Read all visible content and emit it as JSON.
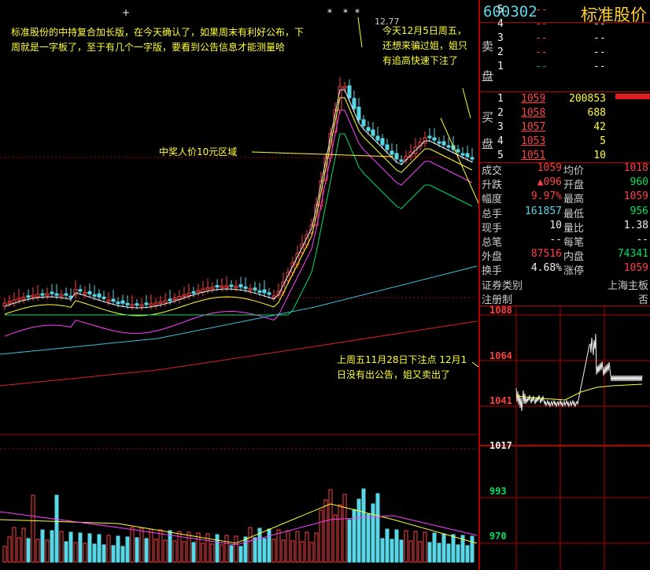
{
  "stock": {
    "code": "600302",
    "name": "标准股价"
  },
  "chart": {
    "peak_label": "12.77",
    "annotations": {
      "top_left": "标准股份的中持复合加长版，在今天确认了，如果周末有利好公布，下周就是一字板了，至于有几个一字版，要看到公告信息才能测量哈",
      "top_right": "今天12月5日周五，还想来骗过姐，姐只有追高快速下注了",
      "mid": "中奖人价10元区域",
      "lower": "上周五11月28日下注点 12月1日没有出公告，姐又卖出了"
    },
    "markers": [
      "+",
      "*",
      "*",
      "*"
    ]
  },
  "order_book": {
    "sell_label": "卖盘",
    "buy_label": "买盘",
    "sells": [
      {
        "level": "5",
        "price": "--",
        "vol": "--"
      },
      {
        "level": "4",
        "price": "--",
        "vol": "--"
      },
      {
        "level": "3",
        "price": "--",
        "vol": "--"
      },
      {
        "level": "2",
        "price": "--",
        "vol": "--"
      },
      {
        "level": "1",
        "price": "--",
        "vol": "--"
      }
    ],
    "buys": [
      {
        "level": "1",
        "price": "1059",
        "vol": "200853"
      },
      {
        "level": "2",
        "price": "1058",
        "vol": "688"
      },
      {
        "level": "3",
        "price": "1057",
        "vol": "42"
      },
      {
        "level": "4",
        "price": "1053",
        "vol": "5"
      },
      {
        "level": "5",
        "price": "1051",
        "vol": "10"
      }
    ]
  },
  "stats": {
    "r1": {
      "l1": "成交",
      "v1": "1059",
      "l2": "均价",
      "v2": "1018"
    },
    "r2": {
      "l1": "升跌",
      "v1": "▲096",
      "l2": "开盘",
      "v2": "960"
    },
    "r3": {
      "l1": "幅度",
      "v1": "9.97%",
      "l2": "最高",
      "v2": "1059"
    },
    "r4": {
      "l1": "总手",
      "v1": "161857",
      "l2": "最低",
      "v2": "956"
    },
    "r5": {
      "l1": "现手",
      "v1": "10",
      "l2": "量比",
      "v2": "1.38"
    },
    "r6": {
      "l1": "总笔",
      "v1": "--",
      "l2": "每笔",
      "v2": "--"
    },
    "r7": {
      "l1": "外盘",
      "v1": "87516",
      "l2": "内盘",
      "v2": "74341"
    },
    "r8": {
      "l1": "换手",
      "v1": "4.68%",
      "l2": "涨停",
      "v2": "1059"
    },
    "r9": {
      "l1": "证券类别",
      "v2": "上海主板"
    },
    "r10": {
      "l1": "注册制",
      "v2": "否"
    }
  },
  "intraday": {
    "levels": [
      "1088",
      "1064",
      "1041",
      "1017",
      "993",
      "970"
    ]
  },
  "colors": {
    "up": "#ff4040",
    "down": "#5ad7e6",
    "grid": "#b40000",
    "annotation": "#ffff33"
  }
}
